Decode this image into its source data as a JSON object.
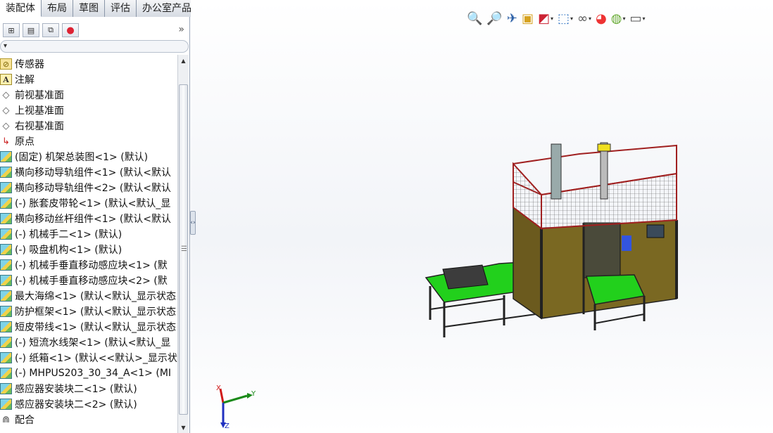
{
  "command_tabs": [
    {
      "label": "装配体",
      "active": true
    },
    {
      "label": "布局",
      "active": false
    },
    {
      "label": "草图",
      "active": false
    },
    {
      "label": "评估",
      "active": false
    },
    {
      "label": "办公室产品",
      "active": false
    }
  ],
  "panel": {
    "more_label": "»",
    "filter_arrow": "▾"
  },
  "tree": [
    {
      "label": "传感器",
      "icon": "sensor-icon"
    },
    {
      "label": "注解",
      "icon": "annotation-icon"
    },
    {
      "label": "前视基准面",
      "icon": "plane-icon"
    },
    {
      "label": "上视基准面",
      "icon": "plane-icon"
    },
    {
      "label": "右视基准面",
      "icon": "plane-icon"
    },
    {
      "label": "原点",
      "icon": "origin-icon"
    },
    {
      "label": "(固定) 机架总装图<1> (默认)",
      "icon": "assembly-icon"
    },
    {
      "label": "横向移动导轨组件<1> (默认<默认",
      "icon": "assembly-icon"
    },
    {
      "label": "横向移动导轨组件<2> (默认<默认",
      "icon": "assembly-icon"
    },
    {
      "label": "(-) 胀套皮带轮<1> (默认<默认_显",
      "icon": "part-icon"
    },
    {
      "label": "横向移动丝杆组件<1> (默认<默认",
      "icon": "assembly-icon"
    },
    {
      "label": "(-) 机械手二<1> (默认)",
      "icon": "assembly-icon"
    },
    {
      "label": "(-) 吸盘机构<1> (默认)",
      "icon": "assembly-icon"
    },
    {
      "label": "(-) 机械手垂直移动感应块<1> (默",
      "icon": "part-icon"
    },
    {
      "label": "(-) 机械手垂直移动感应块<2> (默",
      "icon": "part-icon"
    },
    {
      "label": "最大海绵<1> (默认<默认_显示状态",
      "icon": "part-icon"
    },
    {
      "label": "防护框架<1> (默认<默认_显示状态",
      "icon": "part-icon"
    },
    {
      "label": "短皮带线<1> (默认<默认_显示状态",
      "icon": "part-icon"
    },
    {
      "label": "(-) 短流水线架<1> (默认<默认_显",
      "icon": "part-icon"
    },
    {
      "label": "(-) 纸箱<1> (默认<<默认>_显示状",
      "icon": "part-icon"
    },
    {
      "label": "(-) MHPUS203_30_34_A<1> (MI",
      "icon": "part-icon"
    },
    {
      "label": "感应器安装块二<1> (默认)",
      "icon": "assembly-icon"
    },
    {
      "label": "感应器安装块二<2> (默认)",
      "icon": "assembly-icon"
    },
    {
      "label": "配合",
      "icon": "mates-icon"
    }
  ],
  "triad": {
    "x": "Y",
    "y": "Y",
    "z": "Z",
    "x_axis": "X"
  },
  "colors": {
    "x_axis": "#d01818",
    "y_axis": "#1a8a1a",
    "z_axis": "#2030c0",
    "frame": "#2a2a2a",
    "green": "#22d01c",
    "olive": "#6b5a1e",
    "red_mesh": "#a02020"
  }
}
